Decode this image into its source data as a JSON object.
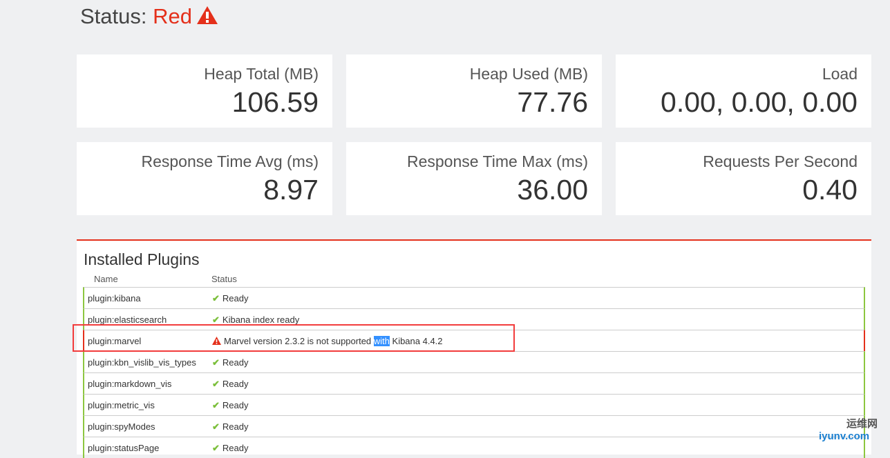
{
  "status": {
    "label": "Status:",
    "value": "Red"
  },
  "cards": [
    {
      "label": "Heap Total (MB)",
      "value": "106.59"
    },
    {
      "label": "Heap Used (MB)",
      "value": "77.76"
    },
    {
      "label": "Load",
      "value": "0.00, 0.00, 0.00"
    },
    {
      "label": "Response Time Avg (ms)",
      "value": "8.97"
    },
    {
      "label": "Response Time Max (ms)",
      "value": "36.00"
    },
    {
      "label": "Requests Per Second",
      "value": "0.40"
    }
  ],
  "plugins": {
    "title": "Installed Plugins",
    "col_name": "Name",
    "col_status": "Status",
    "rows": [
      {
        "name": "plugin:kibana",
        "status": "Ready"
      },
      {
        "name": "plugin:elasticsearch",
        "status": "Kibana index ready"
      },
      {
        "name": "plugin:marvel",
        "status_a": "Marvel version 2.3.2 is not supported ",
        "status_hl": "with",
        "status_b": " Kibana 4.4.2"
      },
      {
        "name": "plugin:kbn_vislib_vis_types",
        "status": "Ready"
      },
      {
        "name": "plugin:markdown_vis",
        "status": "Ready"
      },
      {
        "name": "plugin:metric_vis",
        "status": "Ready"
      },
      {
        "name": "plugin:spyModes",
        "status": "Ready"
      },
      {
        "name": "plugin:statusPage",
        "status": "Ready"
      }
    ]
  },
  "watermark": {
    "cn": "运维网",
    "en": "iyunv.com"
  }
}
